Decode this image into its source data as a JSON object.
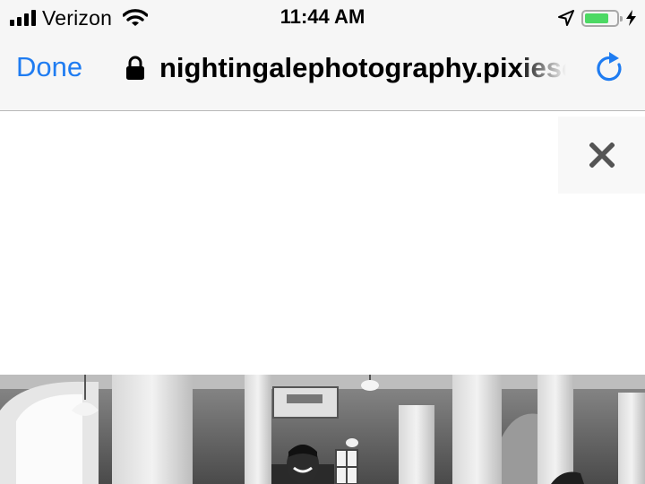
{
  "status_bar": {
    "carrier": "Verizon",
    "time": "11:44 AM",
    "battery_level": 0.75,
    "battery_color": "#4cd964",
    "icons": [
      "signal-bars-icon",
      "wifi-icon",
      "location-arrow-icon",
      "battery-icon",
      "charging-bolt-icon"
    ]
  },
  "nav_bar": {
    "done_label": "Done",
    "url": "nightingalephotography.pixieset.com",
    "accent_color": "#1f7cf1",
    "icons": [
      "lock-icon",
      "reload-icon"
    ]
  },
  "page": {
    "close_icon": "close-icon",
    "photo_description_visible": "black-and-white wedding photo"
  }
}
